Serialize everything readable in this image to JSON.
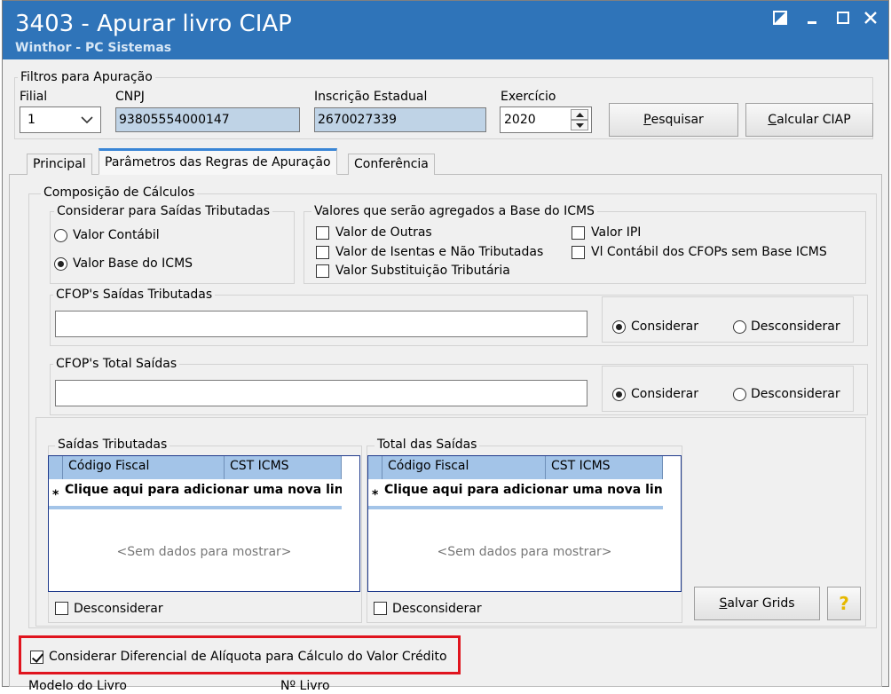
{
  "window": {
    "title": "3403 - Apurar livro CIAP",
    "subtitle": "Winthor - PC Sistemas"
  },
  "filters": {
    "group_label": "Filtros para Apuração",
    "filial_label": "Filial",
    "filial_value": "1",
    "cnpj_label": "CNPJ",
    "cnpj_value": "93805554000147",
    "ie_label": "Inscrição Estadual",
    "ie_value": "2670027339",
    "exercicio_label": "Exercício",
    "exercicio_value": "2020",
    "pesquisar": {
      "pre": "",
      "key": "P",
      "post": "esquisar"
    },
    "calcular": {
      "pre": "",
      "key": "C",
      "post": "alcular CIAP"
    }
  },
  "tabs": [
    {
      "label": "Principal"
    },
    {
      "label": "Parâmetros das Regras de Apuração"
    },
    {
      "label": "Conferência"
    }
  ],
  "composicao": {
    "group_label": "Composição de Cálculos",
    "saidas_group": "Considerar para Saídas Tributadas",
    "radio_contabil": "Valor Contábil",
    "radio_base": "Valor Base do ICMS",
    "agregados_group": "Valores que serão agregados a Base  do ICMS",
    "chk_outras": "Valor de Outras",
    "chk_isentas": "Valor de Isentas e Não Tributadas",
    "chk_st": "Valor Substituição Tributária",
    "chk_ipi": "Valor IPI",
    "chk_cfop_sem_base": "Vl Contábil dos CFOPs sem Base ICMS"
  },
  "cfop_saidas": {
    "group_label": "CFOP's  Saídas Tributadas",
    "value": "",
    "considerar": "Considerar",
    "desconsiderar": "Desconsiderar"
  },
  "cfop_total": {
    "group_label": "CFOP's  Total Saídas",
    "value": "",
    "considerar": "Considerar",
    "desconsiderar": "Desconsiderar"
  },
  "grid_saidas": {
    "group_label": "Saídas Tributadas",
    "col_codigo": "Código Fiscal",
    "col_cst": "CST ICMS",
    "new_row_marker": "*",
    "new_row_text": "Clique aqui para adicionar uma nova linha",
    "empty_text": "<Sem dados para mostrar>",
    "desconsiderar": "Desconsiderar"
  },
  "grid_total": {
    "group_label": "Total das Saídas",
    "col_codigo": "Código Fiscal",
    "col_cst": "CST ICMS",
    "new_row_marker": "*",
    "new_row_text": "Clique aqui para adicionar uma nova linha",
    "empty_text": "<Sem dados para mostrar>",
    "desconsiderar": "Desconsiderar"
  },
  "salvar_grids": {
    "pre": "",
    "key": "S",
    "post": "alvar Grids"
  },
  "help_symbol": "?",
  "diferencial_label": "Considerar Diferencial de Alíquota para Cálculo do Valor Crédito",
  "bottom": {
    "modelo_label": "Modelo do Livro",
    "num_label": "Nº Livro"
  },
  "colors": {
    "titlebar": "#2f74b9",
    "grid_header": "#a3c4e8",
    "readonly_field": "#bfd3e6",
    "highlight": "#e0141e"
  }
}
